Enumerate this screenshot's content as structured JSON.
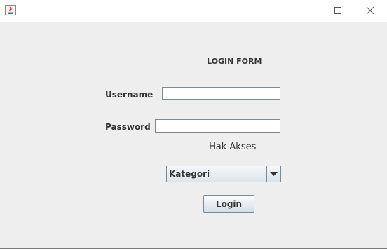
{
  "window": {
    "icon": "java-app-icon",
    "controls": [
      "minimize-icon",
      "maximize-icon",
      "close-icon"
    ]
  },
  "form": {
    "title": "LOGIN FORM",
    "username_label": "Username",
    "username_value": "",
    "password_label": "Password",
    "password_value": "",
    "role_label": "Hak Akses",
    "role_selected": "Kategori",
    "login_label": "Login"
  },
  "colors": {
    "background": "#eeeeee",
    "titlebar": "#ffffff",
    "field_border": "#7a8a99"
  }
}
